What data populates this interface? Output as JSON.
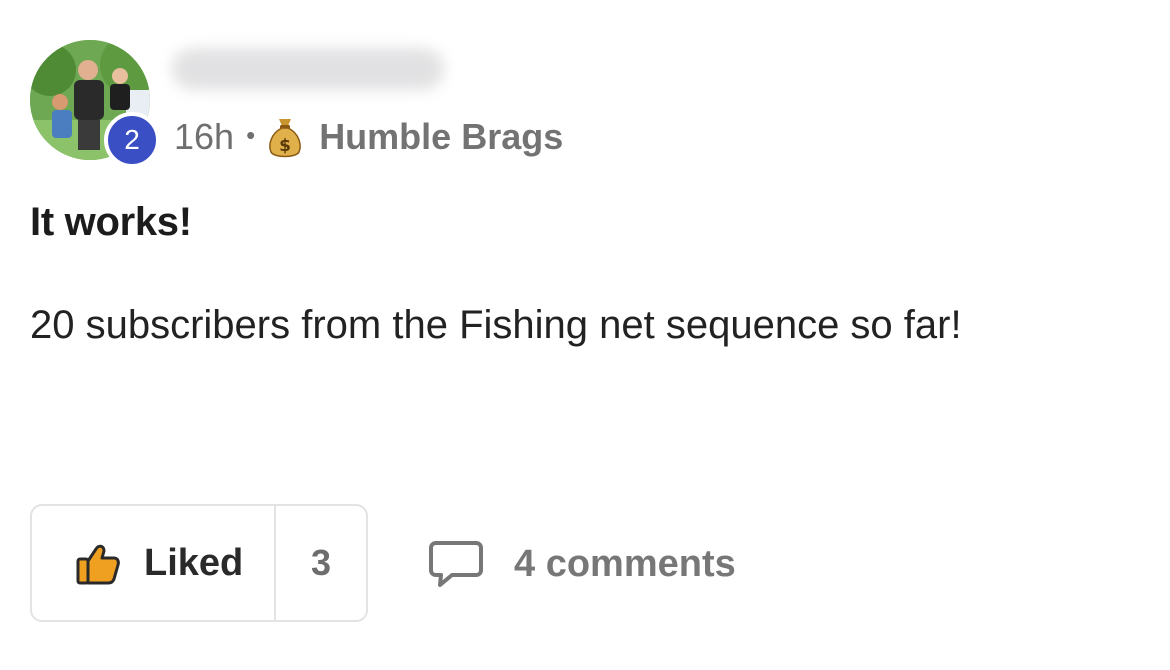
{
  "author": {
    "avatar_alt": "avatar",
    "level": "2"
  },
  "meta": {
    "time": "16h",
    "separator": "•",
    "category_icon": "money-bag-icon",
    "category": "Humble Brags"
  },
  "post": {
    "title": "It works!",
    "body": "20 subscribers from the Fishing net sequence so far!"
  },
  "actions": {
    "like_label": "Liked",
    "like_count": "3",
    "comments_label": "4 comments"
  },
  "colors": {
    "badge": "#3b4fc4",
    "like_icon_fill": "#f0a020"
  }
}
